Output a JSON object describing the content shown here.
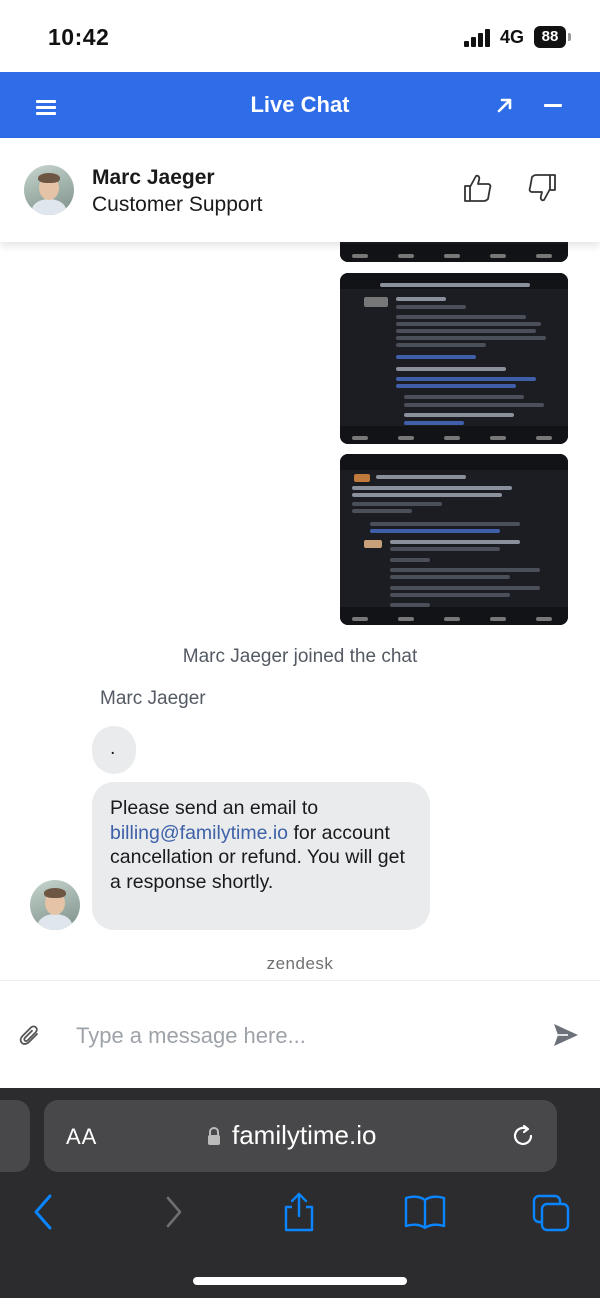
{
  "status_bar": {
    "time": "10:42",
    "network": "4G",
    "battery": "88"
  },
  "header": {
    "title": "Live Chat",
    "menu_icon": "menu-icon",
    "popout_icon": "popout-icon",
    "minimize_icon": "minimize-icon",
    "color": "#2f6de8"
  },
  "agent": {
    "name": "Marc Jaeger",
    "role": "Customer Support"
  },
  "rating": {
    "up_icon": "thumbs-up-icon",
    "down_icon": "thumbs-down-icon"
  },
  "messages": {
    "attachments": [
      "email-screenshot",
      "email-screenshot",
      "email-screenshot"
    ],
    "system": "Marc Jaeger joined the chat",
    "sender": "Marc Jaeger",
    "dot_message": ".",
    "main_message": {
      "before_link": "Please send an email to",
      "link": "billing@familytime.io",
      "after_link": "for account cancellation or refund. You will get a response shortly."
    },
    "link_color": "#3e61a8",
    "bubble_color": "#e9ebed"
  },
  "powered_by": "zendesk",
  "input": {
    "placeholder": "Type a message here...",
    "attach_icon": "paperclip-icon",
    "send_icon": "send-icon"
  },
  "browser": {
    "text_size_label": "AA",
    "url": "familytime.io",
    "toolbar": [
      "back-icon",
      "forward-icon",
      "share-icon",
      "bookmarks-icon",
      "tabs-icon"
    ],
    "accent": "#0a84ff"
  }
}
